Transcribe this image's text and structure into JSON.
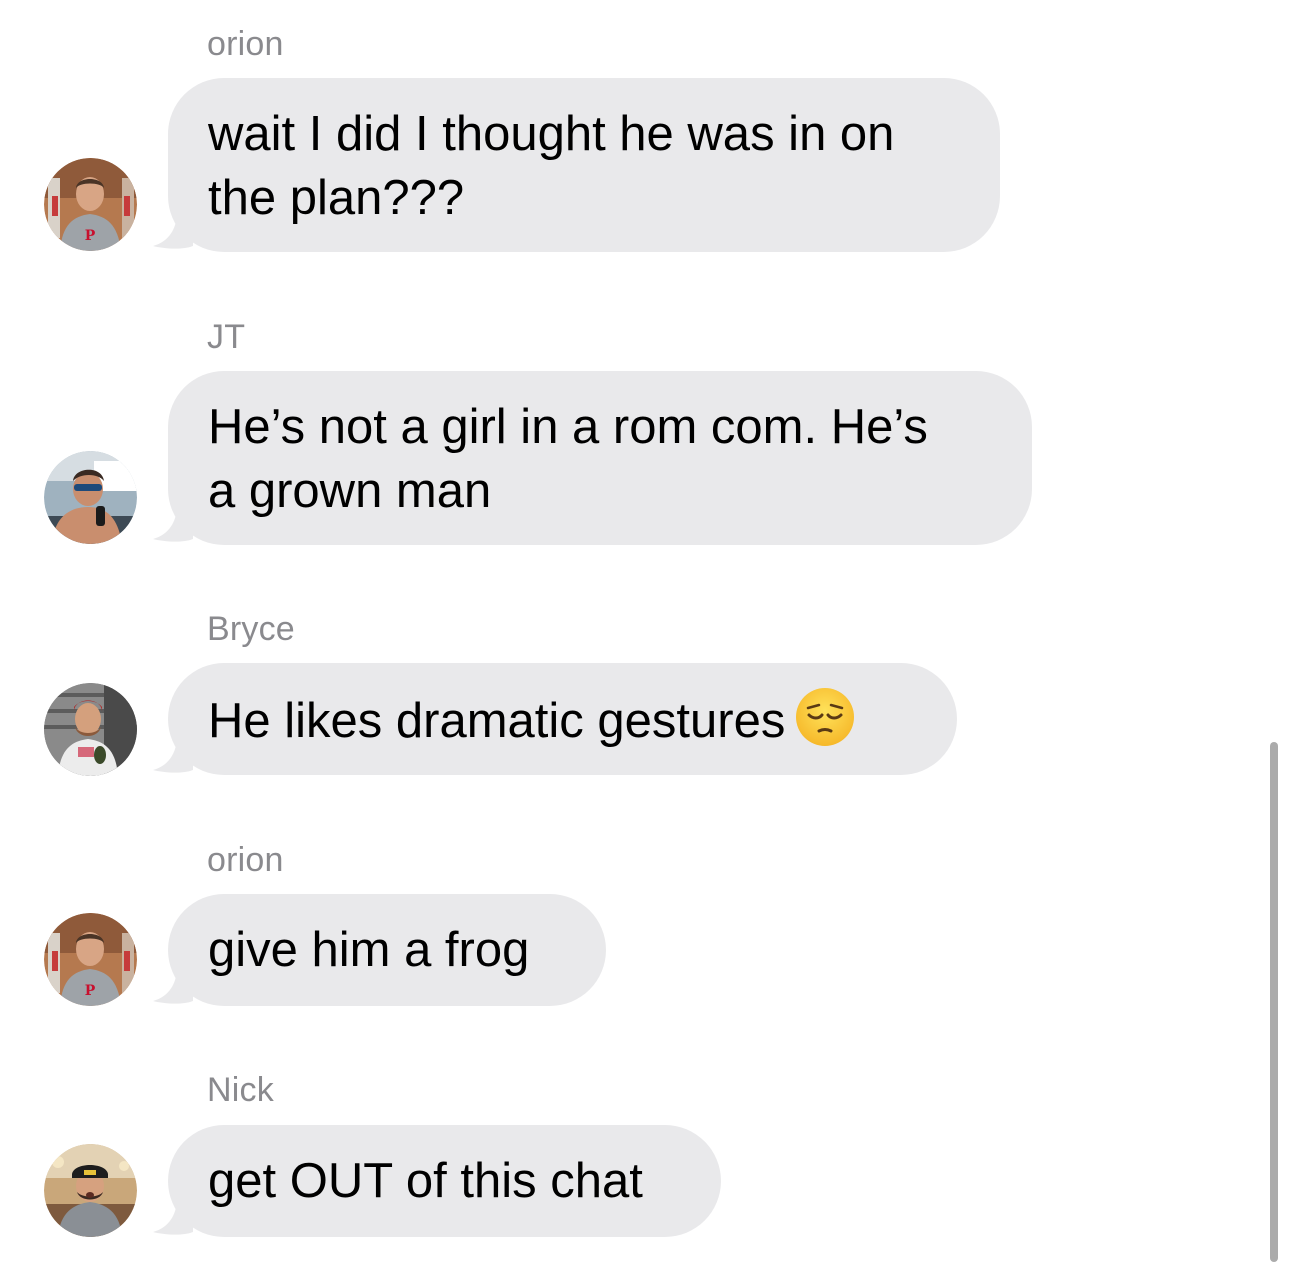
{
  "messages": [
    {
      "sender": "orion",
      "text": "wait I did I thought he was in on\nthe plan???",
      "avatar": "orion-avatar"
    },
    {
      "sender": "JT",
      "text": "He’s not a girl in a rom com. He’s\na grown man",
      "avatar": "jt-avatar"
    },
    {
      "sender": "Bryce",
      "text": "He likes dramatic gestures",
      "emoji": "pensive-face",
      "avatar": "bryce-avatar"
    },
    {
      "sender": "orion",
      "text": "give him a frog",
      "avatar": "orion-avatar"
    },
    {
      "sender": "Nick",
      "text": "get OUT of this chat",
      "avatar": "nick-avatar"
    }
  ],
  "colors": {
    "bubble": "#e9e9eb",
    "sender_text": "#8a8a8e",
    "message_text": "#000000"
  }
}
